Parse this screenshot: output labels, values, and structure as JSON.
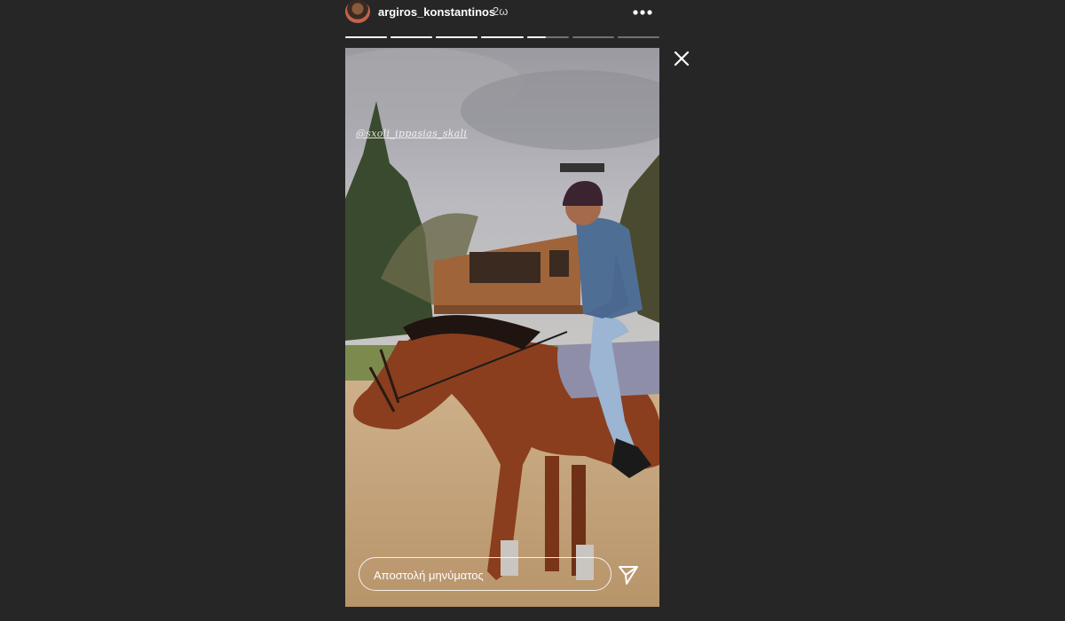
{
  "header": {
    "username": "argiros_konstantinos",
    "time_ago": "2ω",
    "avatar_icon": "user-avatar",
    "more_icon": "more-options-icon"
  },
  "progress": {
    "segments": 7,
    "active_index": 4,
    "active_progress": 0.45,
    "completed": [
      1,
      1,
      1,
      1,
      0.45,
      0,
      0
    ]
  },
  "story": {
    "watermark": "@sxoli_ippasias_skali",
    "reply_placeholder": "Αποστολή μηνύματος",
    "send_icon": "send-icon",
    "close_icon": "close-icon"
  },
  "colors": {
    "background": "#262626",
    "text": "#ffffff"
  }
}
